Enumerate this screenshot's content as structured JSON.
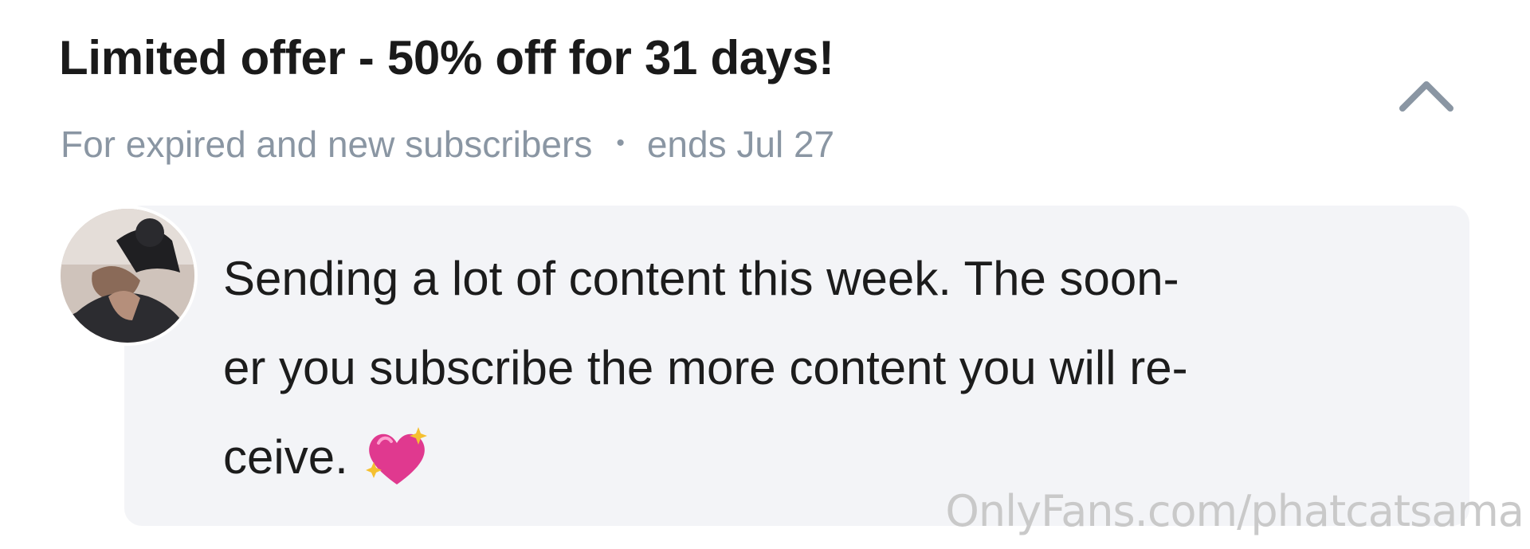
{
  "offer": {
    "title": "Limited offer - 50% off for 31 days!",
    "audience": "For expired and new subscribers",
    "separator": "•",
    "ends": "ends Jul 27"
  },
  "message": {
    "lines": [
      "Sending a lot of content this week. The soon-",
      "er you subscribe the more content you will re-",
      "ceive."
    ],
    "emoji": "sparkling-heart-icon"
  },
  "watermark": "OnlyFans.com/phatcatsama",
  "colors": {
    "title": "#1a1a1a",
    "meta": "#8a96a3",
    "bubble": "#f3f4f7",
    "heart": "#e0398f",
    "sparkle": "#f5c030"
  }
}
